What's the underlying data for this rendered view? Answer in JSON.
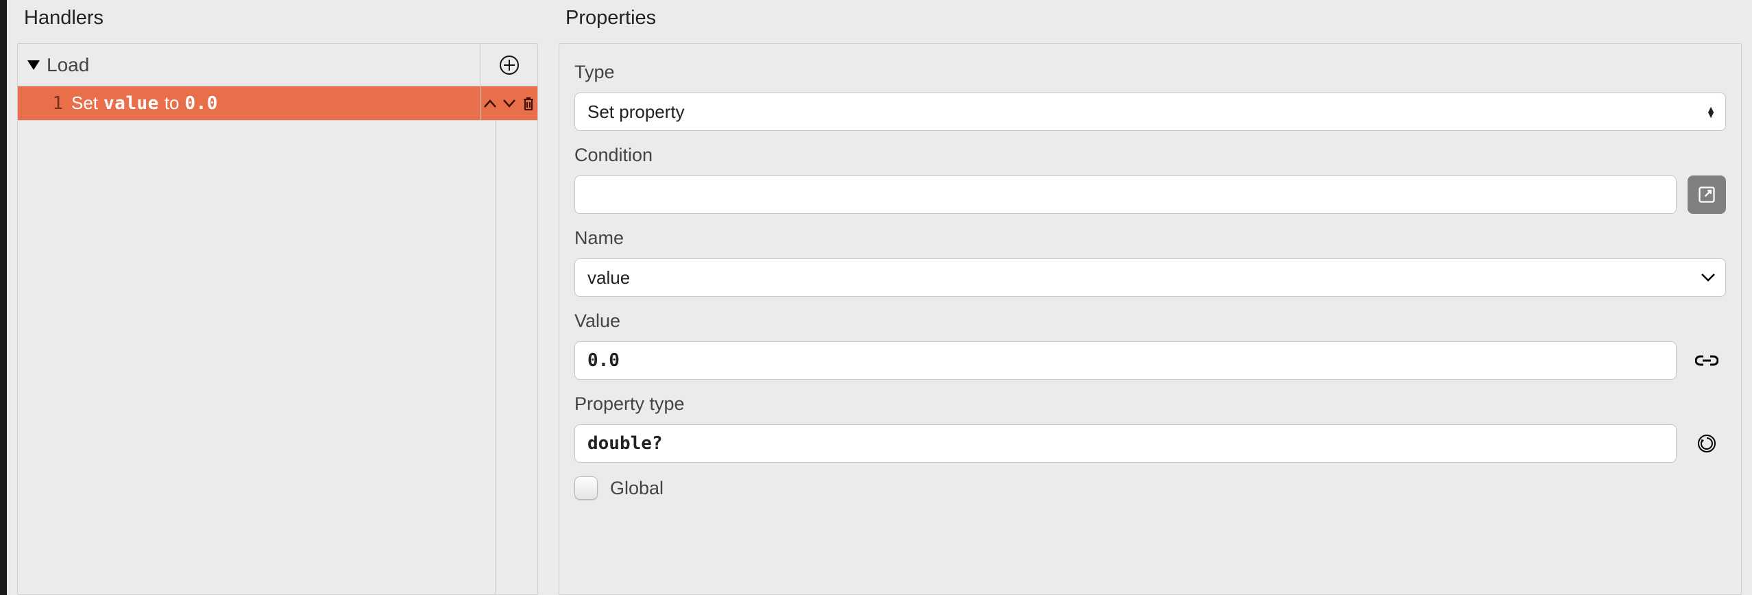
{
  "handlers_panel": {
    "title": "Handlers",
    "handler_name": "Load",
    "row": {
      "index": "1",
      "verb": "Set",
      "var": "value",
      "keyword": "to",
      "value": "0.0"
    }
  },
  "properties_panel": {
    "title": "Properties",
    "type_label": "Type",
    "type_value": "Set property",
    "condition_label": "Condition",
    "condition_value": "",
    "name_label": "Name",
    "name_value": "value",
    "value_label": "Value",
    "value_value": "0.0",
    "property_type_label": "Property type",
    "property_type_value": "double?",
    "global_label": "Global",
    "global_checked": false
  }
}
